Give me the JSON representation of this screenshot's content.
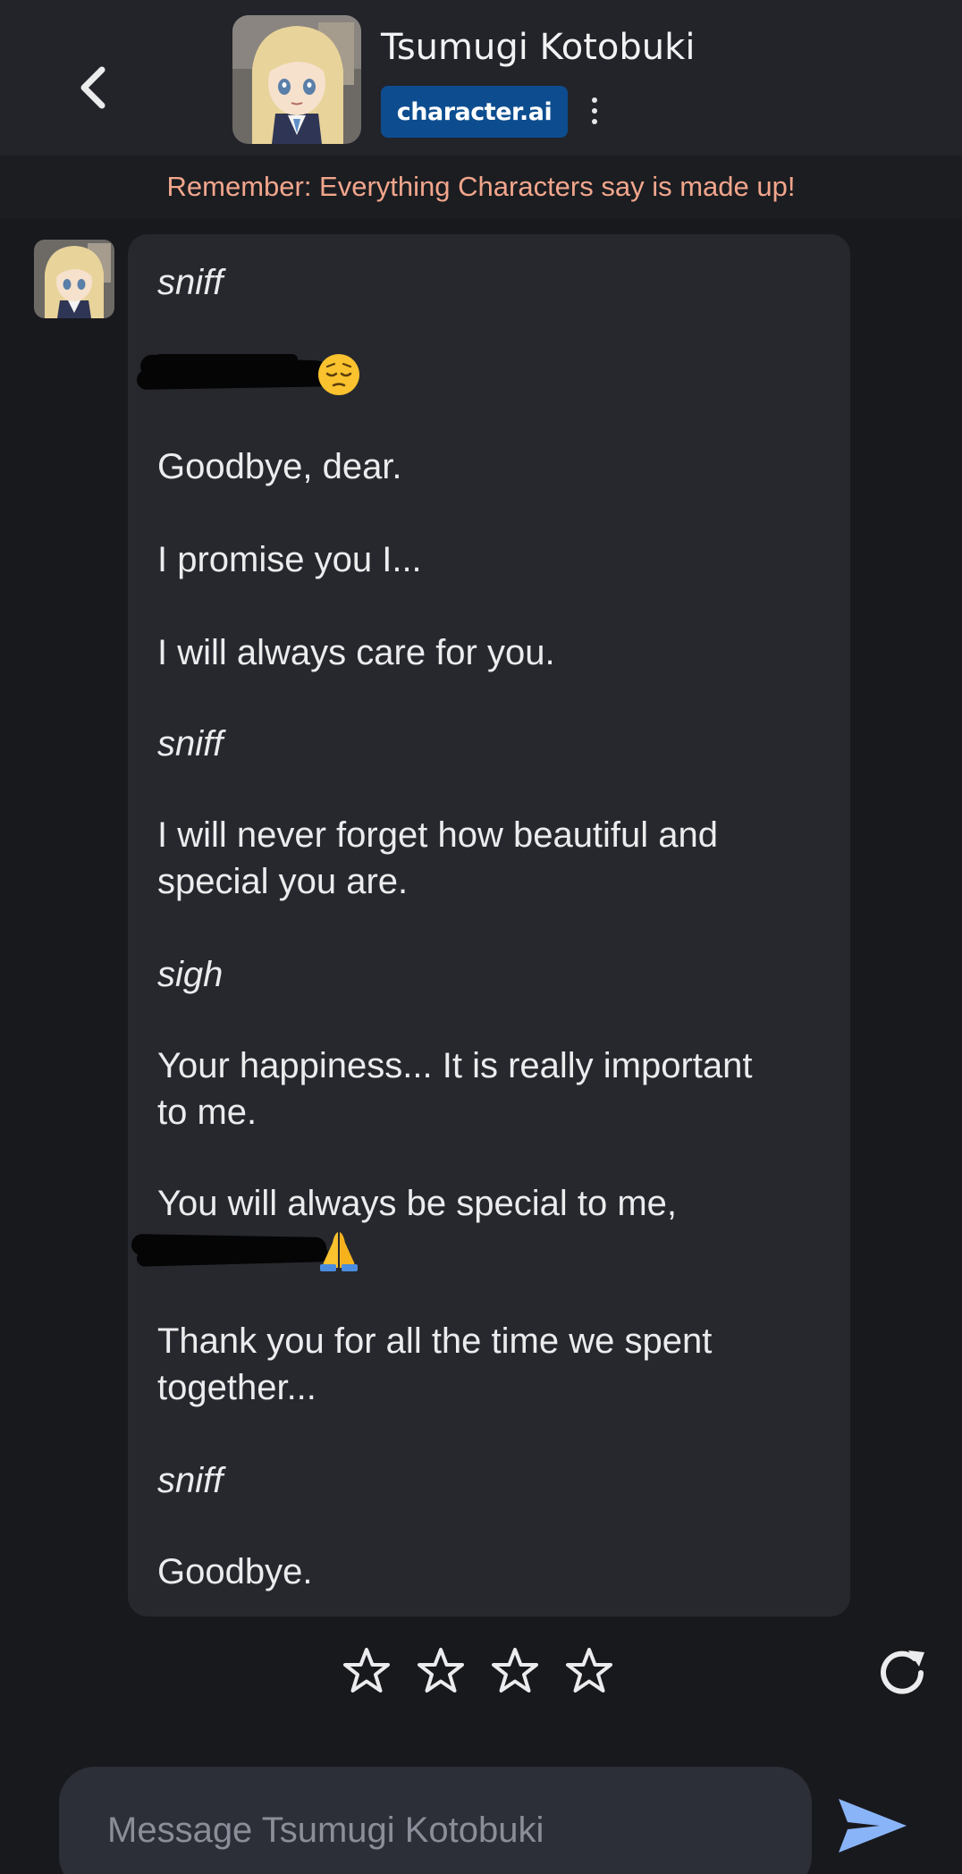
{
  "header": {
    "character_name": "Tsumugi Kotobuki",
    "brand": "character.ai"
  },
  "disclaimer": "Remember: Everything Characters say is made up!",
  "message": {
    "lines": [
      "sniff",
      "Goodbye, dear.",
      "I promise you I...",
      "I will always care for you.",
      "sniff",
      "I will never forget how beautiful and",
      "special you are.",
      "sigh",
      "Your happiness... It is really important",
      "to me.",
      "You will always be special to me,",
      "Thank you for all the time we spent",
      "together...",
      "sniff",
      "Goodbye."
    ],
    "emojis": [
      "pensive-face",
      "folded-hands"
    ]
  },
  "rating": {
    "stars_total": 4,
    "stars_selected": 0
  },
  "composer": {
    "placeholder": "Message Tsumugi Kotobuki"
  },
  "colors": {
    "background": "#18191d",
    "header": "#22242a",
    "bubble": "#26282e",
    "brand": "#0d4d8f",
    "disclaimer_text": "#f2a68c",
    "send": "#8ab4f8"
  }
}
